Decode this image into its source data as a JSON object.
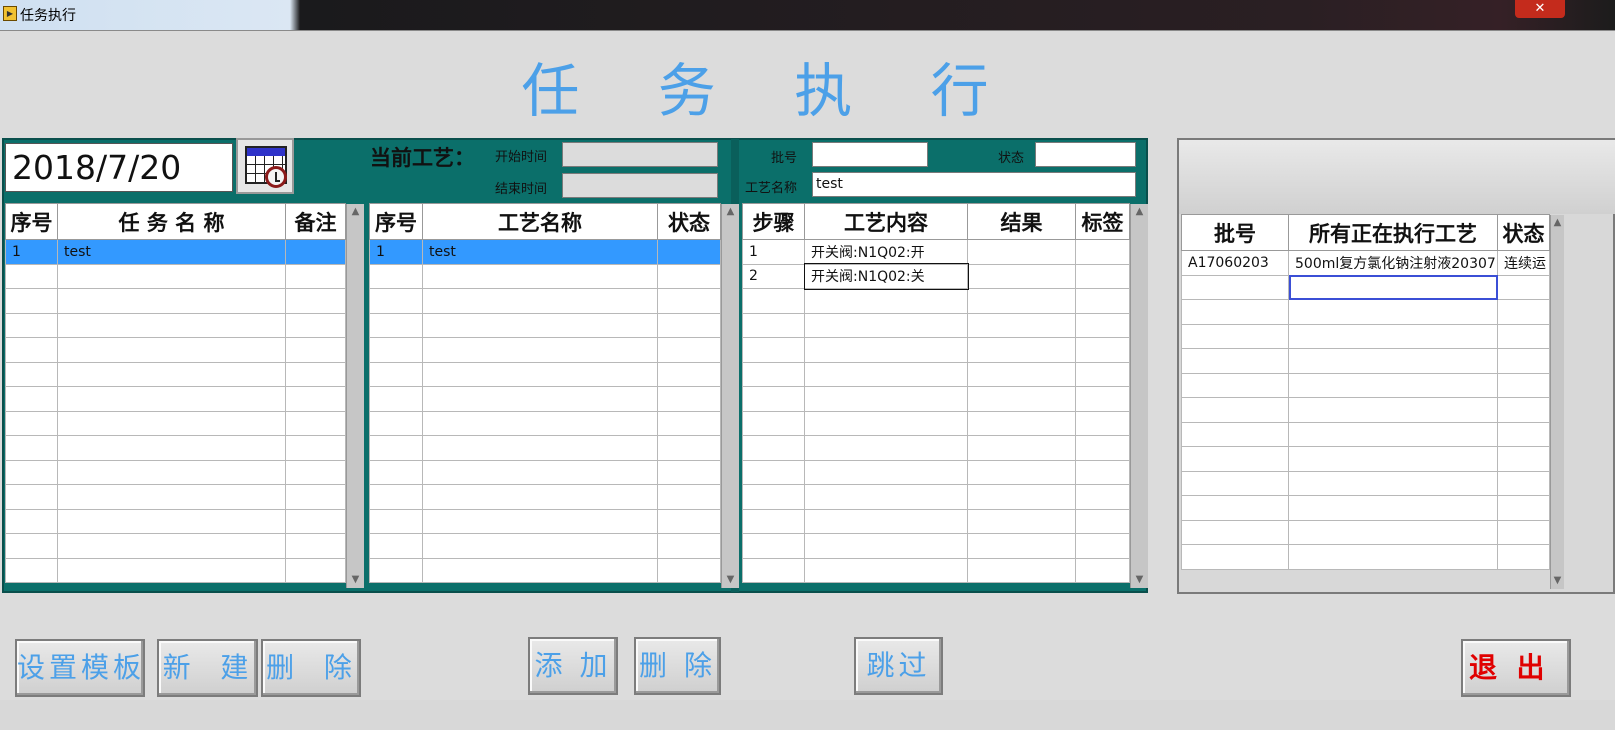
{
  "window": {
    "title": "任务执行",
    "close_label": "✕"
  },
  "heading": "任 务 执 行",
  "date": "2018/7/20",
  "process_info": {
    "current_label": "当前工艺：",
    "start_time_label": "开始时间",
    "end_time_label": "结束时间",
    "batch_label": "批号",
    "status_label": "状态",
    "process_name_label": "工艺名称",
    "process_name_value": "test",
    "start_time_value": "",
    "end_time_value": "",
    "batch_value": "",
    "status_value": ""
  },
  "task_table": {
    "headers": [
      "序号",
      "任 务 名 称",
      "备注"
    ],
    "rows": [
      [
        "1",
        "test",
        ""
      ]
    ]
  },
  "process_table": {
    "headers": [
      "序号",
      "工艺名称",
      "状态"
    ],
    "rows": [
      [
        "1",
        "test",
        ""
      ]
    ]
  },
  "step_table": {
    "headers": [
      "步骤",
      "工艺内容",
      "结果",
      "标签"
    ],
    "rows": [
      [
        "1",
        "开关阀:N1Q02:开",
        "",
        ""
      ],
      [
        "2",
        "开关阀:N1Q02:关",
        "",
        ""
      ]
    ]
  },
  "running_table": {
    "headers": [
      "批号",
      "所有正在执行工艺",
      "状态"
    ],
    "rows": [
      [
        "A17060203",
        "500ml复方氯化钠注射液20307",
        "连续运"
      ]
    ]
  },
  "buttons": {
    "set_template": "设置模板",
    "new": "新  建",
    "delete1": "删  除",
    "add": "添 加",
    "delete2": "删 除",
    "skip": "跳过",
    "exit": "退  出"
  }
}
